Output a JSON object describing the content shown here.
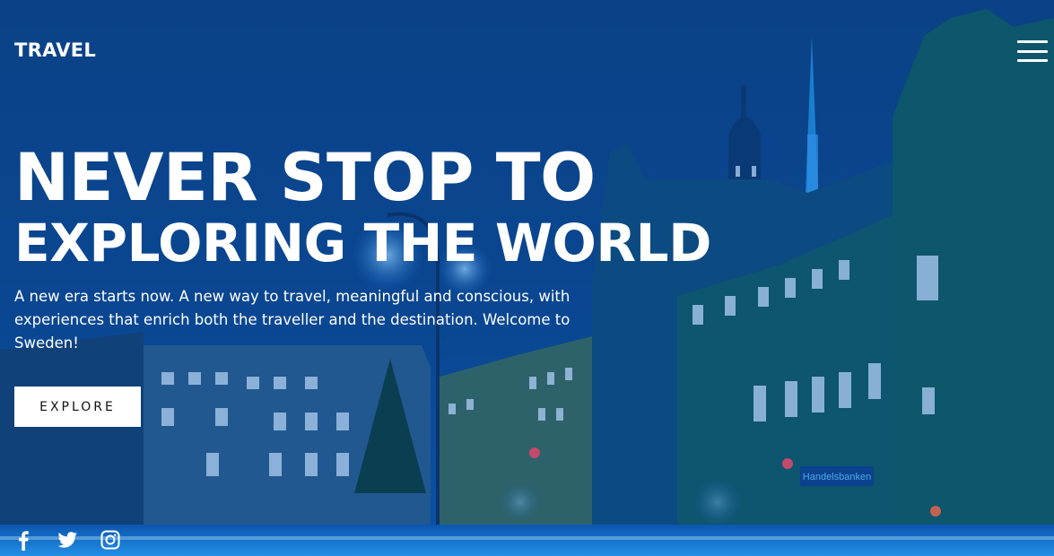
{
  "header": {
    "logo_text": "TRAVEL",
    "menu_icon": "hamburger-menu-icon"
  },
  "hero": {
    "headline_line1": "NEVER STOP TO",
    "headline_line2": "EXPLORING THE WORLD",
    "description": "A new era starts now. A new way to travel, meaningful and conscious, with experiences that enrich both the traveller and the destination. Welcome to Sweden!",
    "cta_label": "EXPLORE",
    "background_sign_text": "Handelsbanken"
  },
  "social": [
    {
      "name": "facebook",
      "icon": "facebook-icon"
    },
    {
      "name": "twitter",
      "icon": "twitter-icon"
    },
    {
      "name": "instagram",
      "icon": "instagram-icon"
    }
  ],
  "colors": {
    "overlay": "#0a4a9a",
    "text": "#ffffff",
    "button_bg": "#ffffff",
    "button_text": "#111111"
  }
}
